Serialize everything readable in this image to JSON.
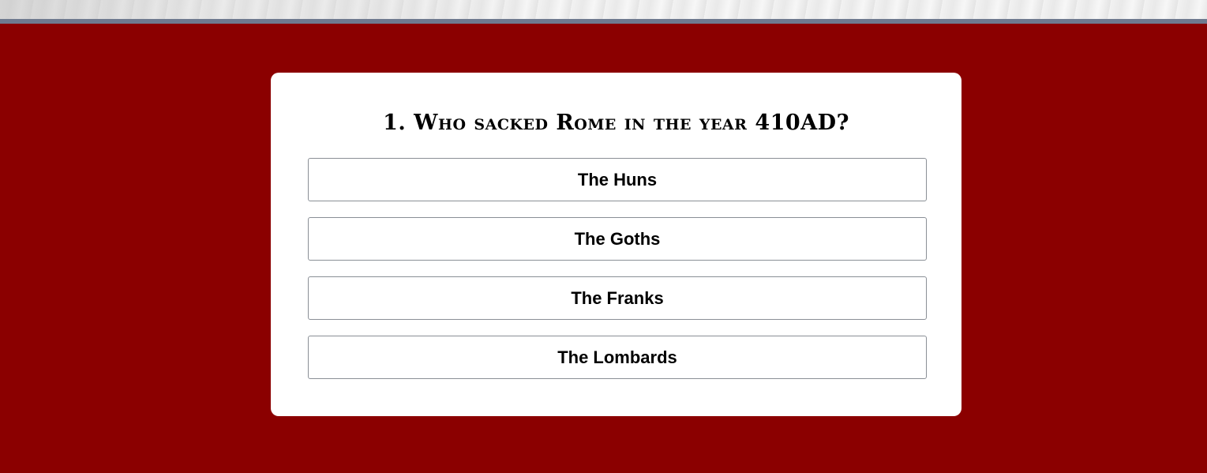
{
  "header": {
    "background": "marble",
    "border_color": "#6f7a8f"
  },
  "theme": {
    "page_background": "#8b0000",
    "card_background": "#ffffff"
  },
  "quiz": {
    "question": "1. Who sacked Rome in the year 410AD?",
    "answers": [
      {
        "label": "The Huns"
      },
      {
        "label": "The Goths"
      },
      {
        "label": "The Franks"
      },
      {
        "label": "The Lombards"
      }
    ]
  }
}
